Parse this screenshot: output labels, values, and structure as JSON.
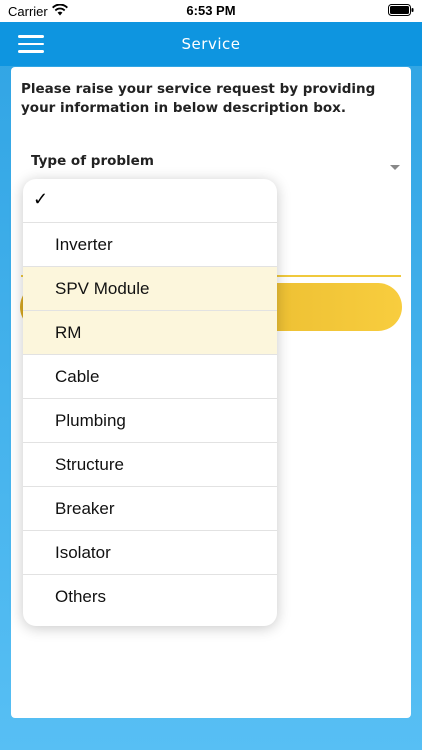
{
  "status_bar": {
    "carrier": "Carrier",
    "time": "6:53 PM"
  },
  "app_bar": {
    "title": "Service",
    "menu_icon": "hamburger-icon"
  },
  "form": {
    "intro": "Please raise your service request by providing your information in below description box.",
    "type_label": "Type of problem"
  },
  "dropdown": {
    "selected_check": "✓",
    "options": [
      {
        "label": "Inverter"
      },
      {
        "label": "SPV Module"
      },
      {
        "label": "RM"
      },
      {
        "label": "Cable"
      },
      {
        "label": "Plumbing"
      },
      {
        "label": "Structure"
      },
      {
        "label": "Breaker"
      },
      {
        "label": "Isolator"
      },
      {
        "label": "Others"
      }
    ]
  },
  "colors": {
    "app_bar": "#0e95e0",
    "accent_yellow": "#f8cd3e",
    "background": "#57bff4"
  }
}
